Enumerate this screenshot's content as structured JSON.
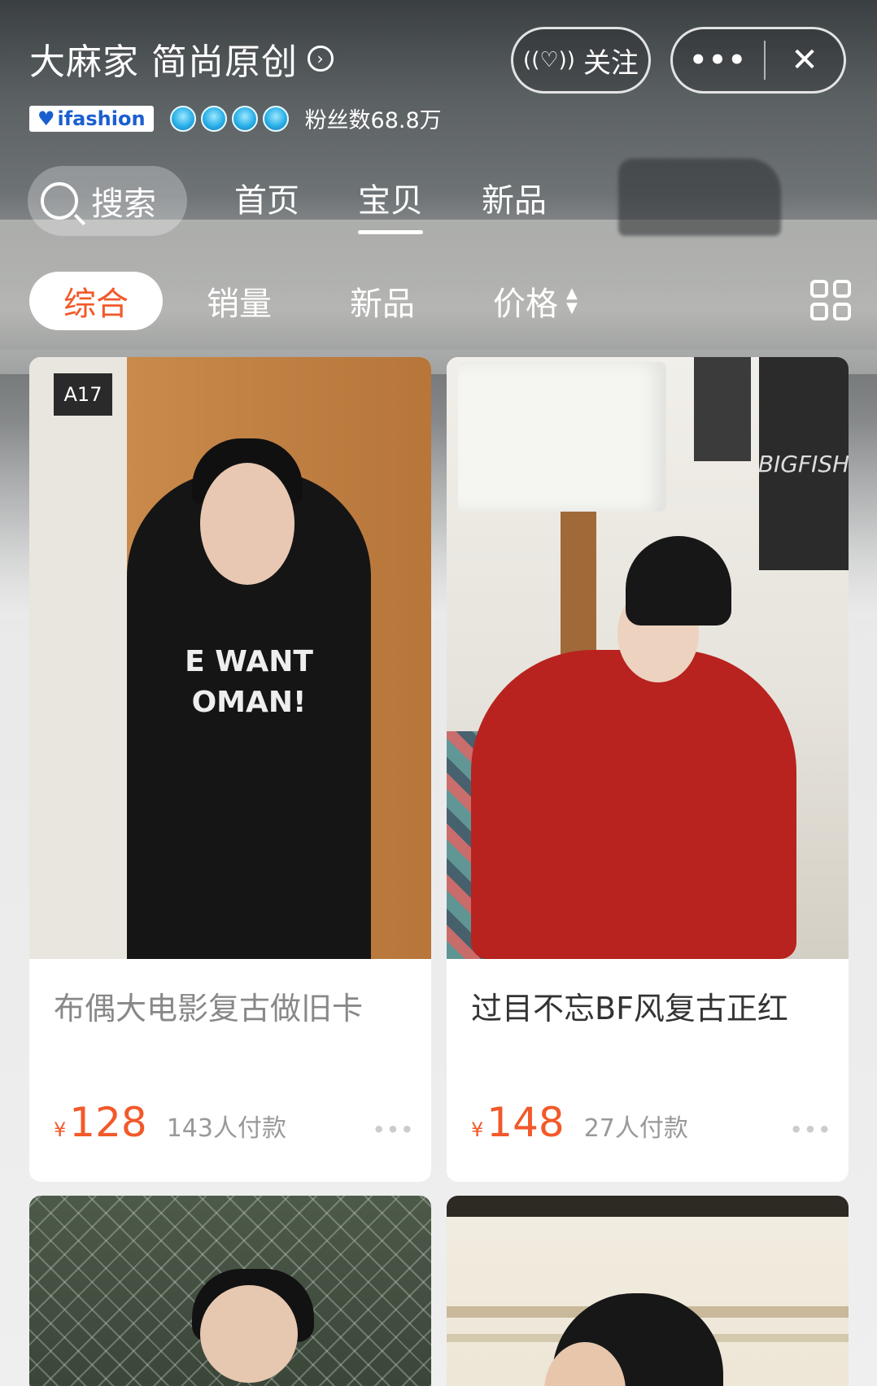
{
  "header": {
    "shop_name": "大麻家 简尚原创",
    "arrow_glyph": "›",
    "follow_label": "关注",
    "follow_icon": "((♡))",
    "more_glyph": "•••",
    "close_glyph": "✕",
    "badge_text": "ifashion",
    "badge_heart": "♥",
    "crown_count": 4,
    "fans_text": "粉丝数68.8万"
  },
  "nav": {
    "search_label": "搜索",
    "tabs": [
      {
        "label": "首页",
        "active": false
      },
      {
        "label": "宝贝",
        "active": true
      },
      {
        "label": "新品",
        "active": false
      }
    ]
  },
  "sort": {
    "items": [
      {
        "label": "综合",
        "active": true
      },
      {
        "label": "销量",
        "active": false
      },
      {
        "label": "新品",
        "active": false
      },
      {
        "label": "价格",
        "active": false,
        "has_arrows": true
      }
    ],
    "arrow_up": "▲",
    "arrow_down": "▼"
  },
  "products": [
    {
      "title": "布偶大电影复古做旧卡",
      "currency": "¥",
      "price": "128",
      "sold": "143人付款",
      "more": "•••",
      "print_text": "E WANT\nOMAN!",
      "sign_text": "A17"
    },
    {
      "title": "过目不忘BF风复古正红",
      "currency": "¥",
      "price": "148",
      "sold": "27人付款",
      "more": "•••",
      "poster_text": "BIGFISH"
    }
  ],
  "colors": {
    "accent": "#f2592a",
    "white": "#ffffff",
    "card_bg": "#ffffff"
  }
}
